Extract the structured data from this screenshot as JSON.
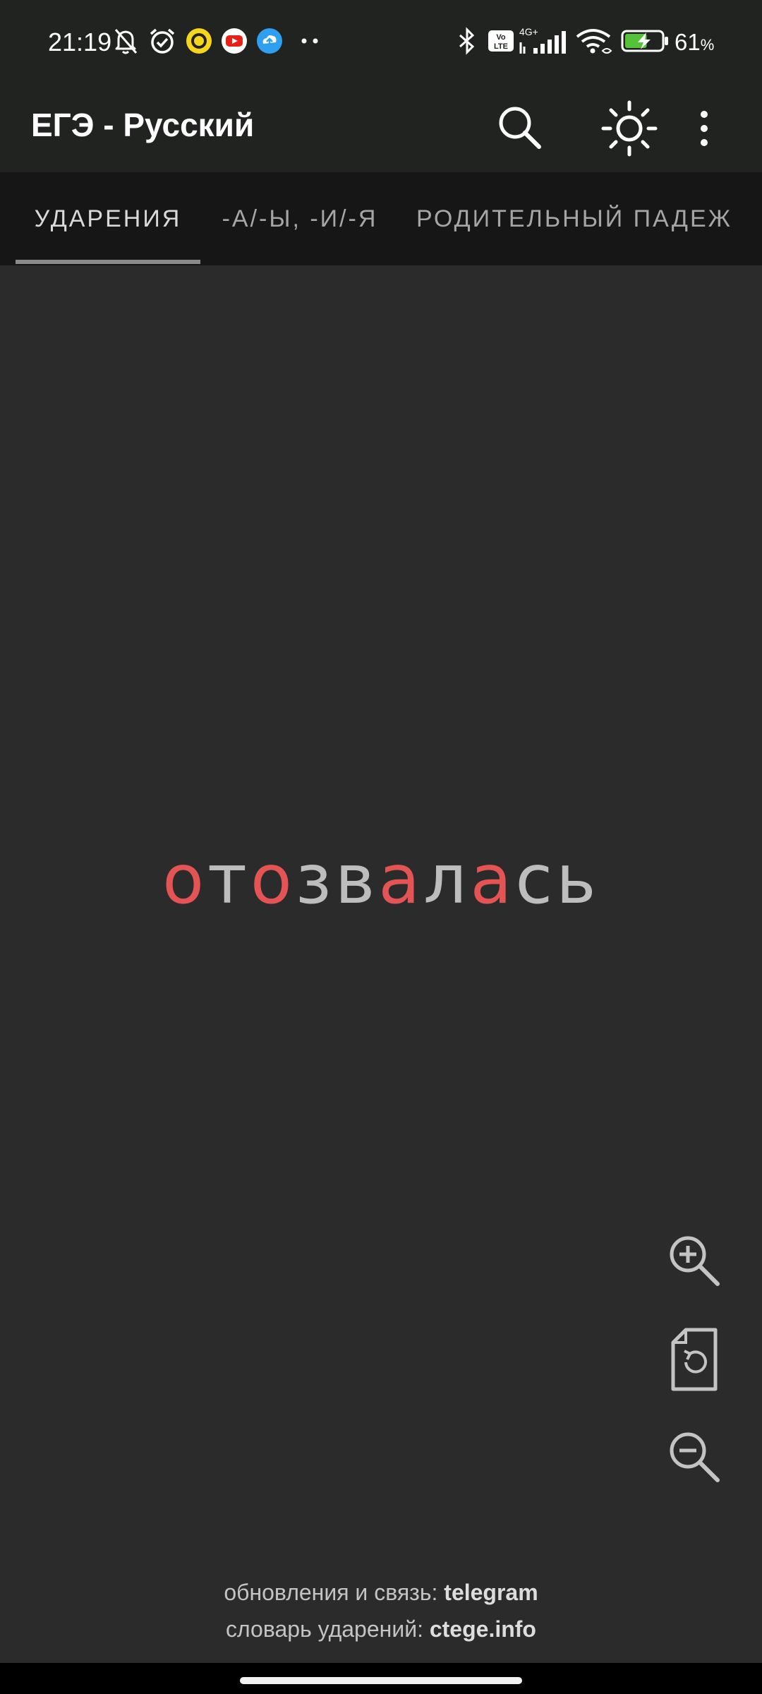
{
  "status_bar": {
    "time": "21:19",
    "network_label": "4G+",
    "volte_label": "Vo LTE",
    "battery_percent": "61",
    "battery_unit": "%",
    "battery_level": 0.61,
    "notification_icons": [
      "bell-off-icon",
      "alarm-icon",
      "app-yellow-ring-icon",
      "youtube-icon",
      "cloud-upload-icon",
      "more-dots-icon"
    ],
    "system_icons": [
      "bluetooth-icon",
      "volte-icon",
      "signal-icon",
      "wifi-icon",
      "battery-charging-icon"
    ]
  },
  "app_bar": {
    "title": "ЕГЭ - Русский",
    "actions": [
      "search-icon",
      "brightness-icon",
      "more-vert-icon"
    ]
  },
  "tabs": [
    {
      "label": "УДАРЕНИЯ",
      "active": true
    },
    {
      "label": "-А/-Ы, -И/-Я",
      "active": false
    },
    {
      "label": "РОДИТЕЛЬНЫЙ ПАДЕЖ",
      "active": false
    }
  ],
  "word": {
    "letters": [
      {
        "ch": "о",
        "highlight": true
      },
      {
        "ch": "т",
        "highlight": false
      },
      {
        "ch": "о",
        "highlight": true
      },
      {
        "ch": "з",
        "highlight": false
      },
      {
        "ch": "в",
        "highlight": false
      },
      {
        "ch": "а",
        "highlight": true
      },
      {
        "ch": "л",
        "highlight": false
      },
      {
        "ch": "а",
        "highlight": true
      },
      {
        "ch": "с",
        "highlight": false
      },
      {
        "ch": "ь",
        "highlight": false
      }
    ],
    "highlight_color": "#e45454",
    "normal_color": "#bdbdbd"
  },
  "controls": [
    "zoom-in-icon",
    "reset-file-icon",
    "zoom-out-icon"
  ],
  "footer": {
    "line1_prefix": "обновления и связь: ",
    "line1_link": "telegram",
    "line2_prefix": "словарь ударений: ",
    "line2_link": "ctege.info"
  },
  "colors": {
    "background": "#2b2b2b",
    "bars": "#212321",
    "tab_bar": "#161616"
  }
}
